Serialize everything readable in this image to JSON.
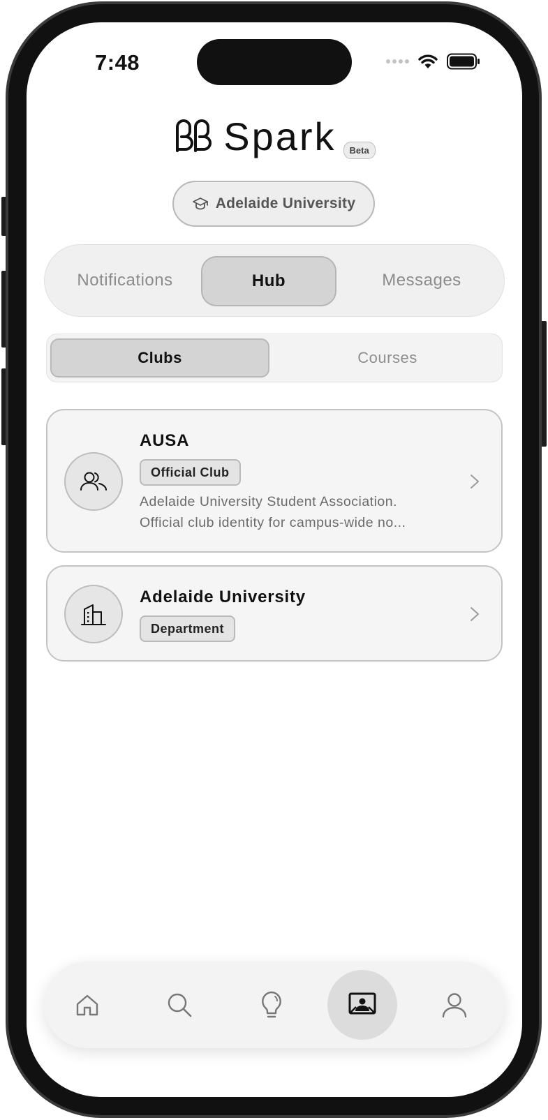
{
  "status_bar": {
    "time": "7:48"
  },
  "brand": {
    "name": "Spark",
    "badge": "Beta"
  },
  "university_selector": {
    "label": "Adelaide University",
    "icon": "graduation-cap-icon"
  },
  "primary_tabs": [
    {
      "label": "Notifications",
      "active": false
    },
    {
      "label": "Hub",
      "active": true
    },
    {
      "label": "Messages",
      "active": false
    }
  ],
  "secondary_tabs": [
    {
      "label": "Clubs",
      "active": true
    },
    {
      "label": "Courses",
      "active": false
    }
  ],
  "items": [
    {
      "title": "AUSA",
      "tag": "Official Club",
      "icon": "users-icon",
      "description_lines": [
        "Adelaide University Student Association.",
        "Official club identity for campus-wide no..."
      ]
    },
    {
      "title": "Adelaide University",
      "tag": "Department",
      "icon": "building-icon",
      "description_lines": []
    }
  ],
  "bottom_nav": [
    {
      "name": "home",
      "icon": "home-icon",
      "active": false
    },
    {
      "name": "search",
      "icon": "search-icon",
      "active": false
    },
    {
      "name": "ideas",
      "icon": "lightbulb-icon",
      "active": false
    },
    {
      "name": "hub",
      "icon": "hub-board-icon",
      "active": true
    },
    {
      "name": "profile",
      "icon": "profile-icon",
      "active": false
    }
  ]
}
